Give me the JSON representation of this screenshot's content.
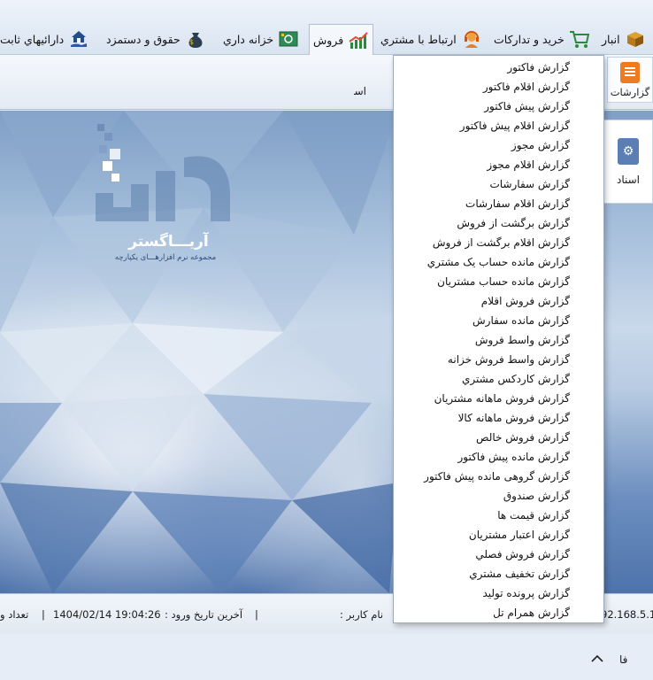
{
  "menubar": {
    "tabs": [
      {
        "label": "انبار",
        "icon": "box-icon"
      },
      {
        "label": "خريد و تداركات",
        "icon": "shopping-cart-icon"
      },
      {
        "label": "ارتباط با مشتري",
        "icon": "headset-icon"
      },
      {
        "label": "فروش",
        "icon": "sales-chart-icon"
      },
      {
        "label": "خزانه داري",
        "icon": "safe-icon"
      },
      {
        "label": "حقوق و دستمزد",
        "icon": "money-bag-icon"
      },
      {
        "label": "دارائيهاي ثابت",
        "icon": "house-hand-icon"
      }
    ]
  },
  "ribbon": {
    "reports_label": "گزارشات",
    "group_label": "اسناد"
  },
  "side_panel": {
    "label": "اسناد"
  },
  "logo": {
    "brand": "آریـــاگستر",
    "tagline": "مجموعه نرم افزارهـــای یکپارچه"
  },
  "statusbar": {
    "ip_fragment": "92.168.5.1",
    "username_label": "نام کاربر :",
    "last_login_label": "آخرین تاریخ ورود :",
    "last_login_value": "1404/02/14  19:04:26",
    "separator": "|",
    "count_label": "تعداد و"
  },
  "bottom": {
    "lang": "فا"
  },
  "dropdown": {
    "items": [
      "گزارش فاكتور",
      "گزارش اقلام فاكتور",
      "گزارش پيش فاكتور",
      "گزارش اقلام پيش فاكتور",
      "گزارش مجوز",
      "گزارش اقلام مجوز",
      "گزارش سفارشات",
      "گزارش اقلام سفارشات",
      "گزارش برگشت از فروش",
      "گزارش اقلام برگشت از فروش",
      "گزارش مانده حساب يک مشتري",
      "گزارش مانده حساب مشتريان",
      "گزارش فروش اقلام",
      "گزارش مانده سفارش",
      "گزارش واسط فروش",
      "گزارش واسط فروش خزانه",
      "گزارش كاردكس مشتري",
      "گزارش فروش ماهانه مشتريان",
      "گزارش فروش ماهانه كالا",
      "گزارش فروش خالص",
      "گزارش مانده پيش فاكتور",
      "گزارش گروهی مانده پيش فاكتور",
      "گزارش صندوق",
      "گزارش قيمت ها",
      "گزارش اعتبار مشتريان",
      "گزارش فروش فصلي",
      "گزارش تخفيف مشتري",
      "گزارش پرونده توليد",
      "گزارش همرام تل"
    ]
  },
  "colors": {
    "accent": "#2f6db5",
    "menubar_bg": "#dfe8f3",
    "dropdown_bg": "#ffffff"
  }
}
